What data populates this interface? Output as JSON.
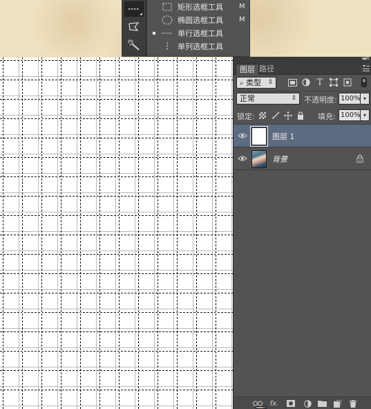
{
  "flyout": {
    "items": [
      {
        "label": "矩形选框工具",
        "shortcut": "M",
        "icon": "rect-marquee-icon",
        "selected": false
      },
      {
        "label": "椭圆选框工具",
        "shortcut": "M",
        "icon": "ellipse-marquee-icon",
        "selected": false
      },
      {
        "label": "单行选框工具",
        "shortcut": "",
        "icon": "single-row-marquee-icon",
        "selected": true
      },
      {
        "label": "单列选框工具",
        "shortcut": "",
        "icon": "single-column-marquee-icon",
        "selected": false
      }
    ]
  },
  "toolbar": {
    "tools": [
      "single-row-marquee-icon",
      "polygonal-lasso-icon",
      "magic-wand-icon"
    ]
  },
  "layers_panel": {
    "tabs": [
      {
        "label": "图层",
        "active": true
      },
      {
        "label": "路径",
        "active": false
      }
    ],
    "filter": {
      "label": "类型",
      "icons": [
        "image-filter-icon",
        "adjustment-filter-icon",
        "type-filter-icon",
        "shape-filter-icon",
        "smart-object-filter-icon"
      ]
    },
    "blend_mode": "正常",
    "opacity_label": "不透明度:",
    "opacity_value": "100%",
    "lock_label": "锁定:",
    "fill_label": "填充:",
    "fill_value": "100%",
    "layers": [
      {
        "name": "图层 1",
        "selected": true,
        "visible": true,
        "thumb": "white",
        "locked": false
      },
      {
        "name": "背景",
        "selected": false,
        "visible": true,
        "thumb": "photo",
        "locked": true
      }
    ],
    "footer_icons": [
      "link-icon",
      "fx-icon",
      "mask-icon",
      "adjustment-icon",
      "group-folder-icon",
      "new-layer-icon",
      "trash-icon"
    ],
    "footer_fx": "fx."
  },
  "colors": {
    "panel_bg": "#535353",
    "selected_layer": "#5c6b80",
    "canvas_bg": "#ffffff",
    "grid_line": "#b8b8b8"
  }
}
